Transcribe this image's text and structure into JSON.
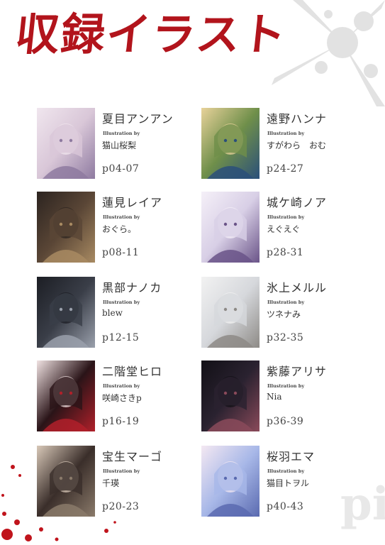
{
  "page": {
    "title": "収録イラスト",
    "bg_text": "pi"
  },
  "colors": {
    "title": "#b2141c",
    "splatter_red": "#c0141c",
    "splatter_gray": "#d0d0d0"
  },
  "entries": [
    {
      "name": "夏目アンアン",
      "illus_label": "Illustration by",
      "artist": "猫山桜梨",
      "pages": "p04-07",
      "palette": [
        "#d9c7d8",
        "#8e7aa0",
        "#f0e6ee"
      ]
    },
    {
      "name": "遠野ハンナ",
      "illus_label": "Illustration by",
      "artist": "すがわら　おむ",
      "pages": "p24-27",
      "palette": [
        "#6f8f4a",
        "#2a4f7a",
        "#e8d29a"
      ]
    },
    {
      "name": "蓮見レイア",
      "illus_label": "Illustration by",
      "artist": "おぐら。",
      "pages": "p08-11",
      "palette": [
        "#5a4636",
        "#a88a62",
        "#2c2420"
      ]
    },
    {
      "name": "城ケ崎ノア",
      "illus_label": "Illustration by",
      "artist": "えぐえぐ",
      "pages": "p28-31",
      "palette": [
        "#d8cfe6",
        "#6a5488",
        "#f5f0f8"
      ]
    },
    {
      "name": "黒部ナノカ",
      "illus_label": "Illustration by",
      "artist": "blew",
      "pages": "p12-15",
      "palette": [
        "#3a3e48",
        "#9aa0ac",
        "#1c1e24"
      ]
    },
    {
      "name": "氷上メルル",
      "illus_label": "Illustration by",
      "artist": "ツネナみ",
      "pages": "p32-35",
      "palette": [
        "#d6d8dc",
        "#8d8a86",
        "#f2f2f2"
      ]
    },
    {
      "name": "二階堂ヒロ",
      "illus_label": "Illustration by",
      "artist": "咲崎さきp",
      "pages": "p16-19",
      "palette": [
        "#2a1418",
        "#b0202a",
        "#f0e2e2"
      ]
    },
    {
      "name": "紫藤アリサ",
      "illus_label": "Illustration by",
      "artist": "Nia",
      "pages": "p36-39",
      "palette": [
        "#2a2230",
        "#8a4a5a",
        "#121016"
      ]
    },
    {
      "name": "宝生マーゴ",
      "illus_label": "Illustration by",
      "artist": "千瑛",
      "pages": "p20-23",
      "palette": [
        "#3a2e2a",
        "#8a7a6a",
        "#d8c8b8"
      ]
    },
    {
      "name": "桜羽エマ",
      "illus_label": "Illustration by",
      "artist": "猫目トヲル",
      "pages": "p40-43",
      "palette": [
        "#a8b8e8",
        "#5a6ab0",
        "#f4e8f2"
      ]
    }
  ]
}
